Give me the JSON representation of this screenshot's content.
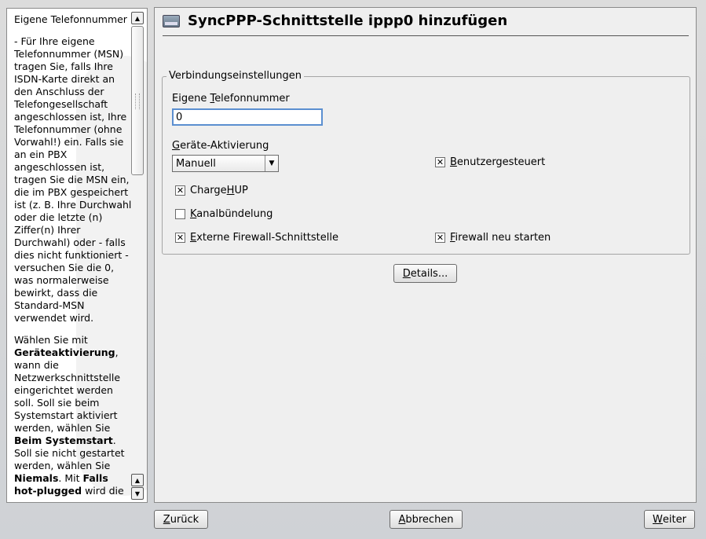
{
  "help": {
    "title": "Eigene Telefonnummer",
    "paragraphs": [
      [
        {
          "text": "- Für Ihre eigene Telefonnummer (MSN) tragen Sie, falls Ihre ISDN-Karte direkt an den Anschluss der Telefongesellschaft angeschlossen ist, Ihre Telefonnummer (ohne Vorwahl!) ein. Falls sie an ein PBX angeschlossen ist, tragen Sie die MSN ein, die im PBX gespeichert ist (z. B. Ihre Durchwahl oder die letzte (n) Ziffer(n) Ihrer Durchwahl) oder - falls dies nicht funktioniert - versuchen Sie die 0, was normalerweise bewirkt, dass die Standard-MSN verwendet wird.",
          "bold": false
        }
      ],
      [
        {
          "text": "Wählen Sie mit ",
          "bold": false
        },
        {
          "text": "Geräteaktivierung",
          "bold": true
        },
        {
          "text": ", wann die Netzwerkschnittstelle eingerichtet werden soll. Soll sie beim Systemstart aktiviert werden, wählen Sie ",
          "bold": false
        },
        {
          "text": "Beim Systemstart",
          "bold": true
        },
        {
          "text": ". Soll sie nicht gestartet werden, wählen Sie ",
          "bold": false
        },
        {
          "text": "Niemals",
          "bold": true
        },
        {
          "text": ". Mit ",
          "bold": false
        },
        {
          "text": "Falls hot-plugged",
          "bold": true
        },
        {
          "text": " wird die",
          "bold": false
        }
      ]
    ]
  },
  "main": {
    "title": "SyncPPP-Schnittstelle ippp0 hinzufügen",
    "group_legend": "Verbindungseinstellungen",
    "phone_label_pre": "Eigene ",
    "phone_label_u": "T",
    "phone_label_post": "elefonnummer",
    "phone_value": "0",
    "activation_label_u": "G",
    "activation_label_post": "eräte-Aktivierung",
    "activation_selected": "Manuell",
    "checkboxes": {
      "user_controlled": {
        "u": "B",
        "rest": "enutzergesteuert",
        "checked": true
      },
      "chargehup": {
        "pre": "Charge",
        "u": "H",
        "rest": "UP",
        "checked": true
      },
      "channel_bundling": {
        "u": "K",
        "rest": "analbündelung",
        "checked": false
      },
      "external_firewall": {
        "u": "E",
        "rest": "xterne Firewall-Schnittstelle",
        "checked": true
      },
      "restart_firewall": {
        "u": "F",
        "rest": "irewall neu starten",
        "checked": true
      }
    },
    "details_u": "D",
    "details_rest": "etails..."
  },
  "footer": {
    "back_u": "Z",
    "back_rest": "urück",
    "cancel_u": "A",
    "cancel_rest": "bbrechen",
    "next_u": "W",
    "next_rest": "eiter"
  },
  "icons": {
    "title_icon": "network-card-icon",
    "scroll_up": "▲",
    "scroll_down": "▼",
    "combo_arrow": "▼",
    "check_mark": "✕"
  }
}
